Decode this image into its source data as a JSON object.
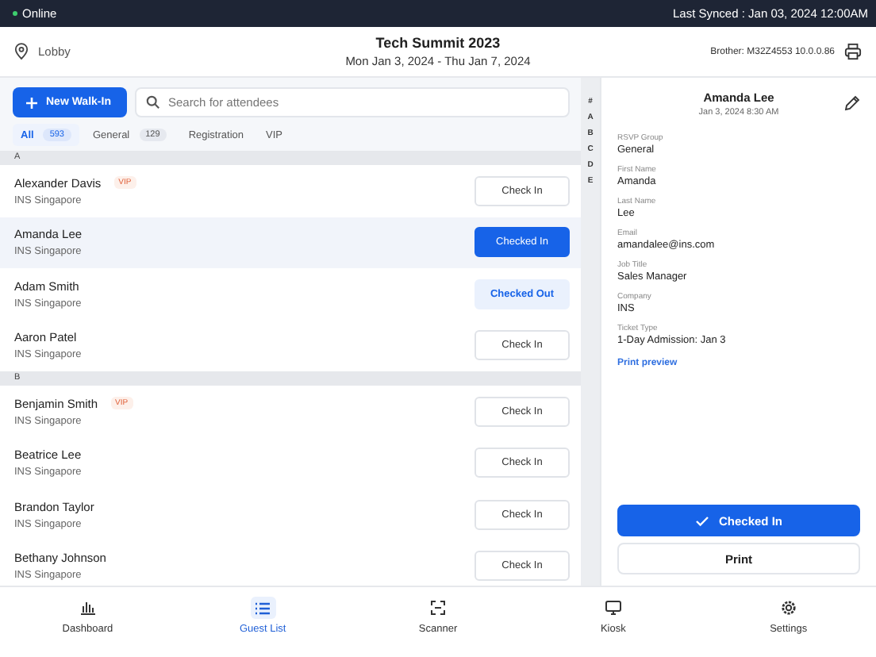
{
  "status_bar": {
    "connection": "Online",
    "online": true,
    "last_synced": "Last Synced : Jan 03, 2024 12:00AM"
  },
  "header": {
    "location": "Lobby",
    "title": "Tech Summit 2023",
    "dates": "Mon Jan 3, 2024 - Thu Jan 7, 2024",
    "printer": "Brother: M32Z4553 10.0.0.86"
  },
  "toolbar": {
    "new_button": "New Walk-In",
    "search": {
      "placeholder": "Search for attendees"
    }
  },
  "tabs": [
    {
      "label": "All",
      "count": "593",
      "selected": true
    },
    {
      "label": "General",
      "count": "129",
      "selected": false
    },
    {
      "label": "Registration",
      "selected": false
    },
    {
      "label": "VIP",
      "selected": false
    }
  ],
  "sections": [
    {
      "letter": "A",
      "guests": [
        {
          "name": "Alexander Davis",
          "company": "INS Singapore",
          "vip": true,
          "badge": "VIP",
          "kind": "check_in",
          "action": "Check In",
          "selected": false
        },
        {
          "name": "Amanda Lee",
          "company": "INS Singapore",
          "vip": false,
          "kind": "checked_in",
          "action": "Checked In",
          "selected": true
        },
        {
          "name": "Adam Smith",
          "company": "INS Singapore",
          "vip": false,
          "kind": "checked_out",
          "action": "Checked Out",
          "selected": false
        },
        {
          "name": "Aaron Patel",
          "company": "INS Singapore",
          "vip": false,
          "kind": "check_in",
          "action": "Check In",
          "selected": false
        }
      ]
    },
    {
      "letter": "B",
      "guests": [
        {
          "name": "Benjamin Smith",
          "company": "INS Singapore",
          "vip": true,
          "badge": "VIP",
          "kind": "check_in",
          "action": "Check In",
          "selected": false
        },
        {
          "name": "Beatrice Lee",
          "company": "INS Singapore",
          "vip": false,
          "kind": "check_in",
          "action": "Check In",
          "selected": false
        },
        {
          "name": "Brandon Taylor",
          "company": "INS Singapore",
          "vip": false,
          "kind": "check_in",
          "action": "Check In",
          "selected": false
        },
        {
          "name": "Bethany Johnson",
          "company": "INS Singapore",
          "vip": false,
          "kind": "check_in",
          "action": "Check In",
          "selected": false
        }
      ]
    }
  ],
  "alpha_index": [
    "#",
    "A",
    "B",
    "C",
    "D",
    "E"
  ],
  "detail": {
    "name": "Amanda Lee",
    "timestamp": "Jan 3, 2024 8:30 AM",
    "fields": [
      {
        "label": "RSVP Group",
        "value": "General"
      },
      {
        "label": "First Name",
        "value": "Amanda"
      },
      {
        "label": "Last Name",
        "value": "Lee"
      },
      {
        "label": "Email",
        "value": "amandalee@ins.com"
      },
      {
        "label": "Job Title",
        "value": "Sales Manager"
      },
      {
        "label": "Company",
        "value": "INS"
      },
      {
        "label": "Ticket Type",
        "value": "1-Day Admission: Jan 3"
      }
    ],
    "print_preview": "Print preview",
    "checked_in": true,
    "status_button": "Checked  In",
    "print_button": "Print"
  },
  "bottom_nav": [
    {
      "label": "Dashboard",
      "kind": "chart",
      "selected": false
    },
    {
      "label": "Guest List",
      "kind": "list",
      "selected": true
    },
    {
      "label": "Scanner",
      "kind": "scan",
      "selected": false
    },
    {
      "label": "Kiosk",
      "kind": "monitor",
      "selected": false
    },
    {
      "label": "Settings",
      "kind": "gear",
      "selected": false
    }
  ]
}
